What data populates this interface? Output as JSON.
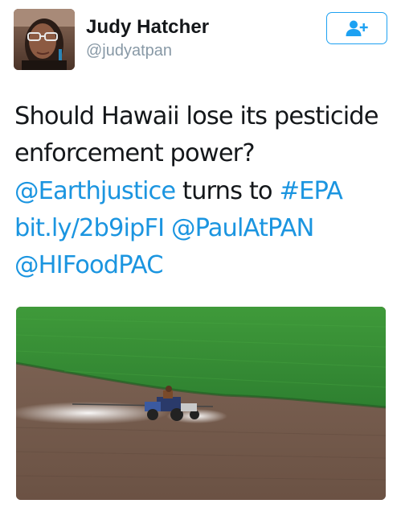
{
  "user": {
    "name": "Judy Hatcher",
    "handle": "@judyatpan"
  },
  "follow_button": {
    "icon": "add-user-icon",
    "accent_color": "#1da1f2"
  },
  "tweet": {
    "segments": [
      {
        "text": "Should Hawaii lose its pesticide enforcement power? ",
        "type": "text"
      },
      {
        "text": "@Earthjustice",
        "type": "mention"
      },
      {
        "text": " turns to ",
        "type": "text"
      },
      {
        "text": "#EPA",
        "type": "hashtag"
      },
      {
        "text": " ",
        "type": "text"
      },
      {
        "text": "bit.ly/2b9ipFI",
        "type": "url"
      },
      {
        "text": " ",
        "type": "text"
      },
      {
        "text": "@PaulAtPAN",
        "type": "mention"
      },
      {
        "text": " ",
        "type": "text"
      },
      {
        "text": "@HIFoodPAC",
        "type": "mention"
      }
    ],
    "link_color": "#1b95e0"
  },
  "media": {
    "kind": "photo",
    "subject": "tractor spraying pesticide on a field"
  }
}
